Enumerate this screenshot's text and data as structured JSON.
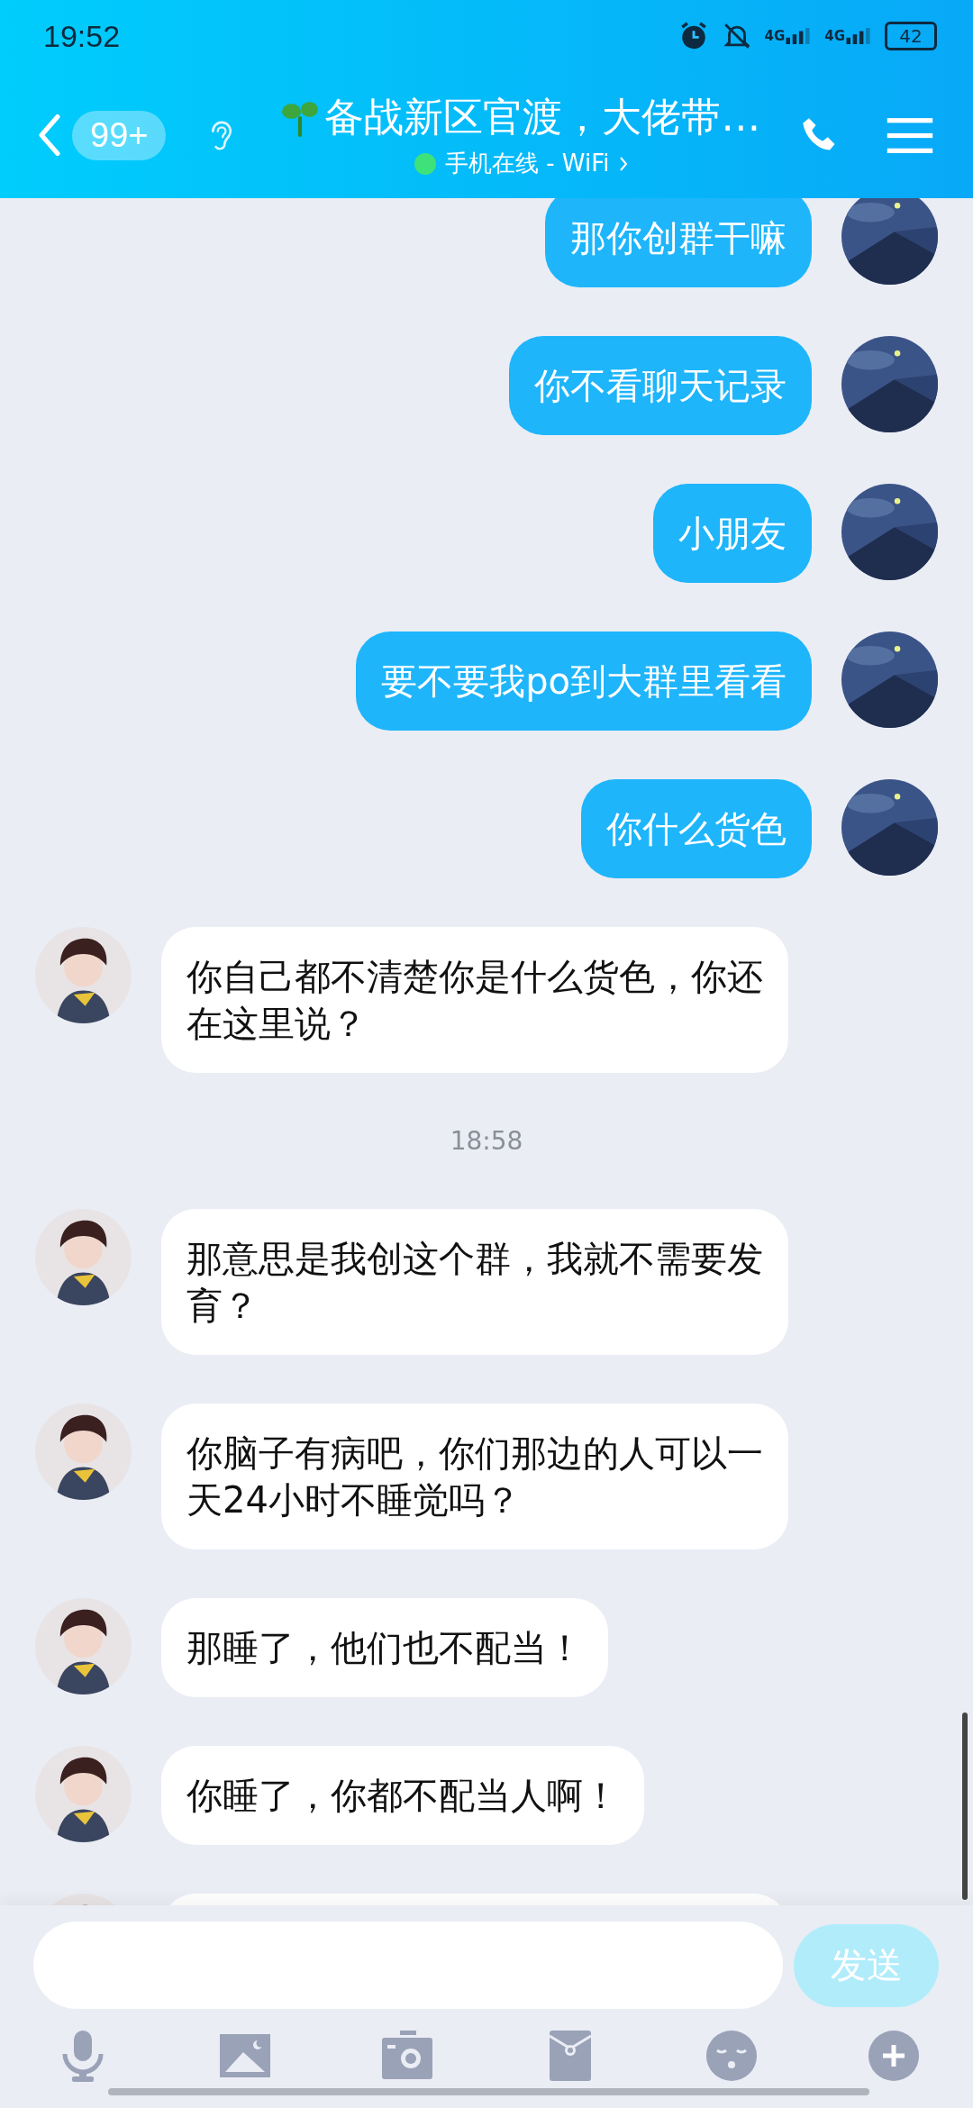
{
  "status_bar": {
    "time": "19:52",
    "networks": [
      "4G",
      "4G"
    ],
    "battery": "42"
  },
  "header": {
    "unread_badge": "99+",
    "title": "备战新区官渡，大佬带…",
    "online": true,
    "subtitle": "手机在线 - WiFi"
  },
  "messages": [
    {
      "kind": "sent",
      "text": "那你创群干嘛"
    },
    {
      "kind": "sent",
      "text": "你不看聊天记录"
    },
    {
      "kind": "sent",
      "text": "小朋友"
    },
    {
      "kind": "sent",
      "text": "要不要我po到大群里看看"
    },
    {
      "kind": "sent",
      "text": "你什么货色"
    },
    {
      "kind": "received",
      "text": "你自己都不清楚你是什么货色，你还在这里说？"
    },
    {
      "kind": "time",
      "text": "18:58"
    },
    {
      "kind": "received",
      "text": "那意思是我创这个群，我就不需要发育？"
    },
    {
      "kind": "received",
      "text": "你脑子有病吧，你们那边的人可以一天24小时不睡觉吗？"
    },
    {
      "kind": "received",
      "text": "那睡了，他们也不配当！"
    },
    {
      "kind": "received",
      "text": "你睡了，你都不配当人啊！"
    },
    {
      "kind": "received"
    }
  ],
  "composer": {
    "send_button": {
      "label": "发送",
      "disabled": true
    }
  }
}
